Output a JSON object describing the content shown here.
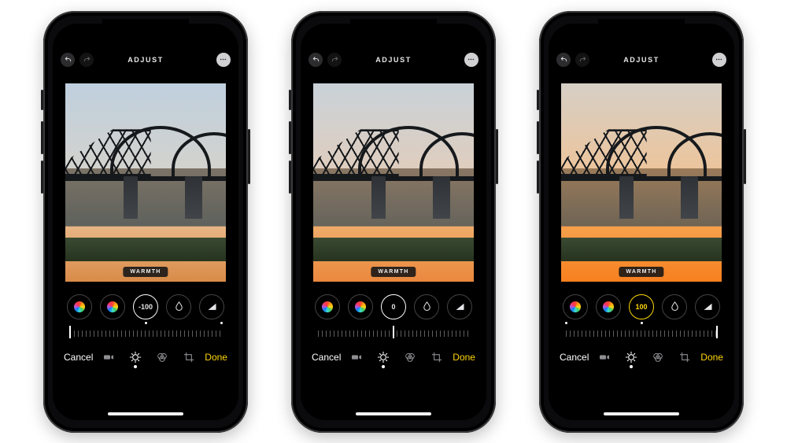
{
  "header": {
    "title": "ADJUST"
  },
  "adjust": {
    "parameter_label": "WARMTH",
    "knobs": [
      {
        "id": "vibrance",
        "kind": "rainbow"
      },
      {
        "id": "saturation",
        "kind": "rainbow"
      },
      {
        "id": "warmth",
        "kind": "value",
        "active": true
      },
      {
        "id": "tint",
        "kind": "drop"
      },
      {
        "id": "sharpness",
        "kind": "triangle"
      }
    ]
  },
  "footer": {
    "cancel_label": "Cancel",
    "done_label": "Done",
    "modes": [
      {
        "id": "video",
        "active": false
      },
      {
        "id": "adjust",
        "active": true
      },
      {
        "id": "filters",
        "active": false
      },
      {
        "id": "crop",
        "active": false
      }
    ]
  },
  "phones": [
    {
      "id": "cool",
      "warmth_value": "-100",
      "value_color": "white",
      "slider_pos_pct": 0,
      "center_dot_pct": 50,
      "right_dot_pct": 100,
      "sky": {
        "top": "#bfd0de",
        "mid": "#d4d2cd",
        "low": "#e8b889",
        "horiz": "#d98a46"
      },
      "water": {
        "a": "#7c7366",
        "b": "#5e615c"
      }
    },
    {
      "id": "neutral",
      "warmth_value": "0",
      "value_color": "white",
      "slider_pos_pct": 50,
      "center_dot_pct": null,
      "right_dot_pct": null,
      "sky": {
        "top": "#c9d2d9",
        "mid": "#e0cdbd",
        "low": "#f0ae6c",
        "horiz": "#ea873c"
      },
      "water": {
        "a": "#8a7763",
        "b": "#66645c"
      }
    },
    {
      "id": "warm",
      "warmth_value": "100",
      "value_color": "yellow",
      "slider_pos_pct": 100,
      "center_dot_pct": 50,
      "right_dot_pct": 0,
      "sky": {
        "top": "#d6cfc6",
        "mid": "#edc49a",
        "low": "#f7a24f",
        "horiz": "#f77f1d"
      },
      "water": {
        "a": "#9a7b5a",
        "b": "#6f6454"
      }
    }
  ]
}
